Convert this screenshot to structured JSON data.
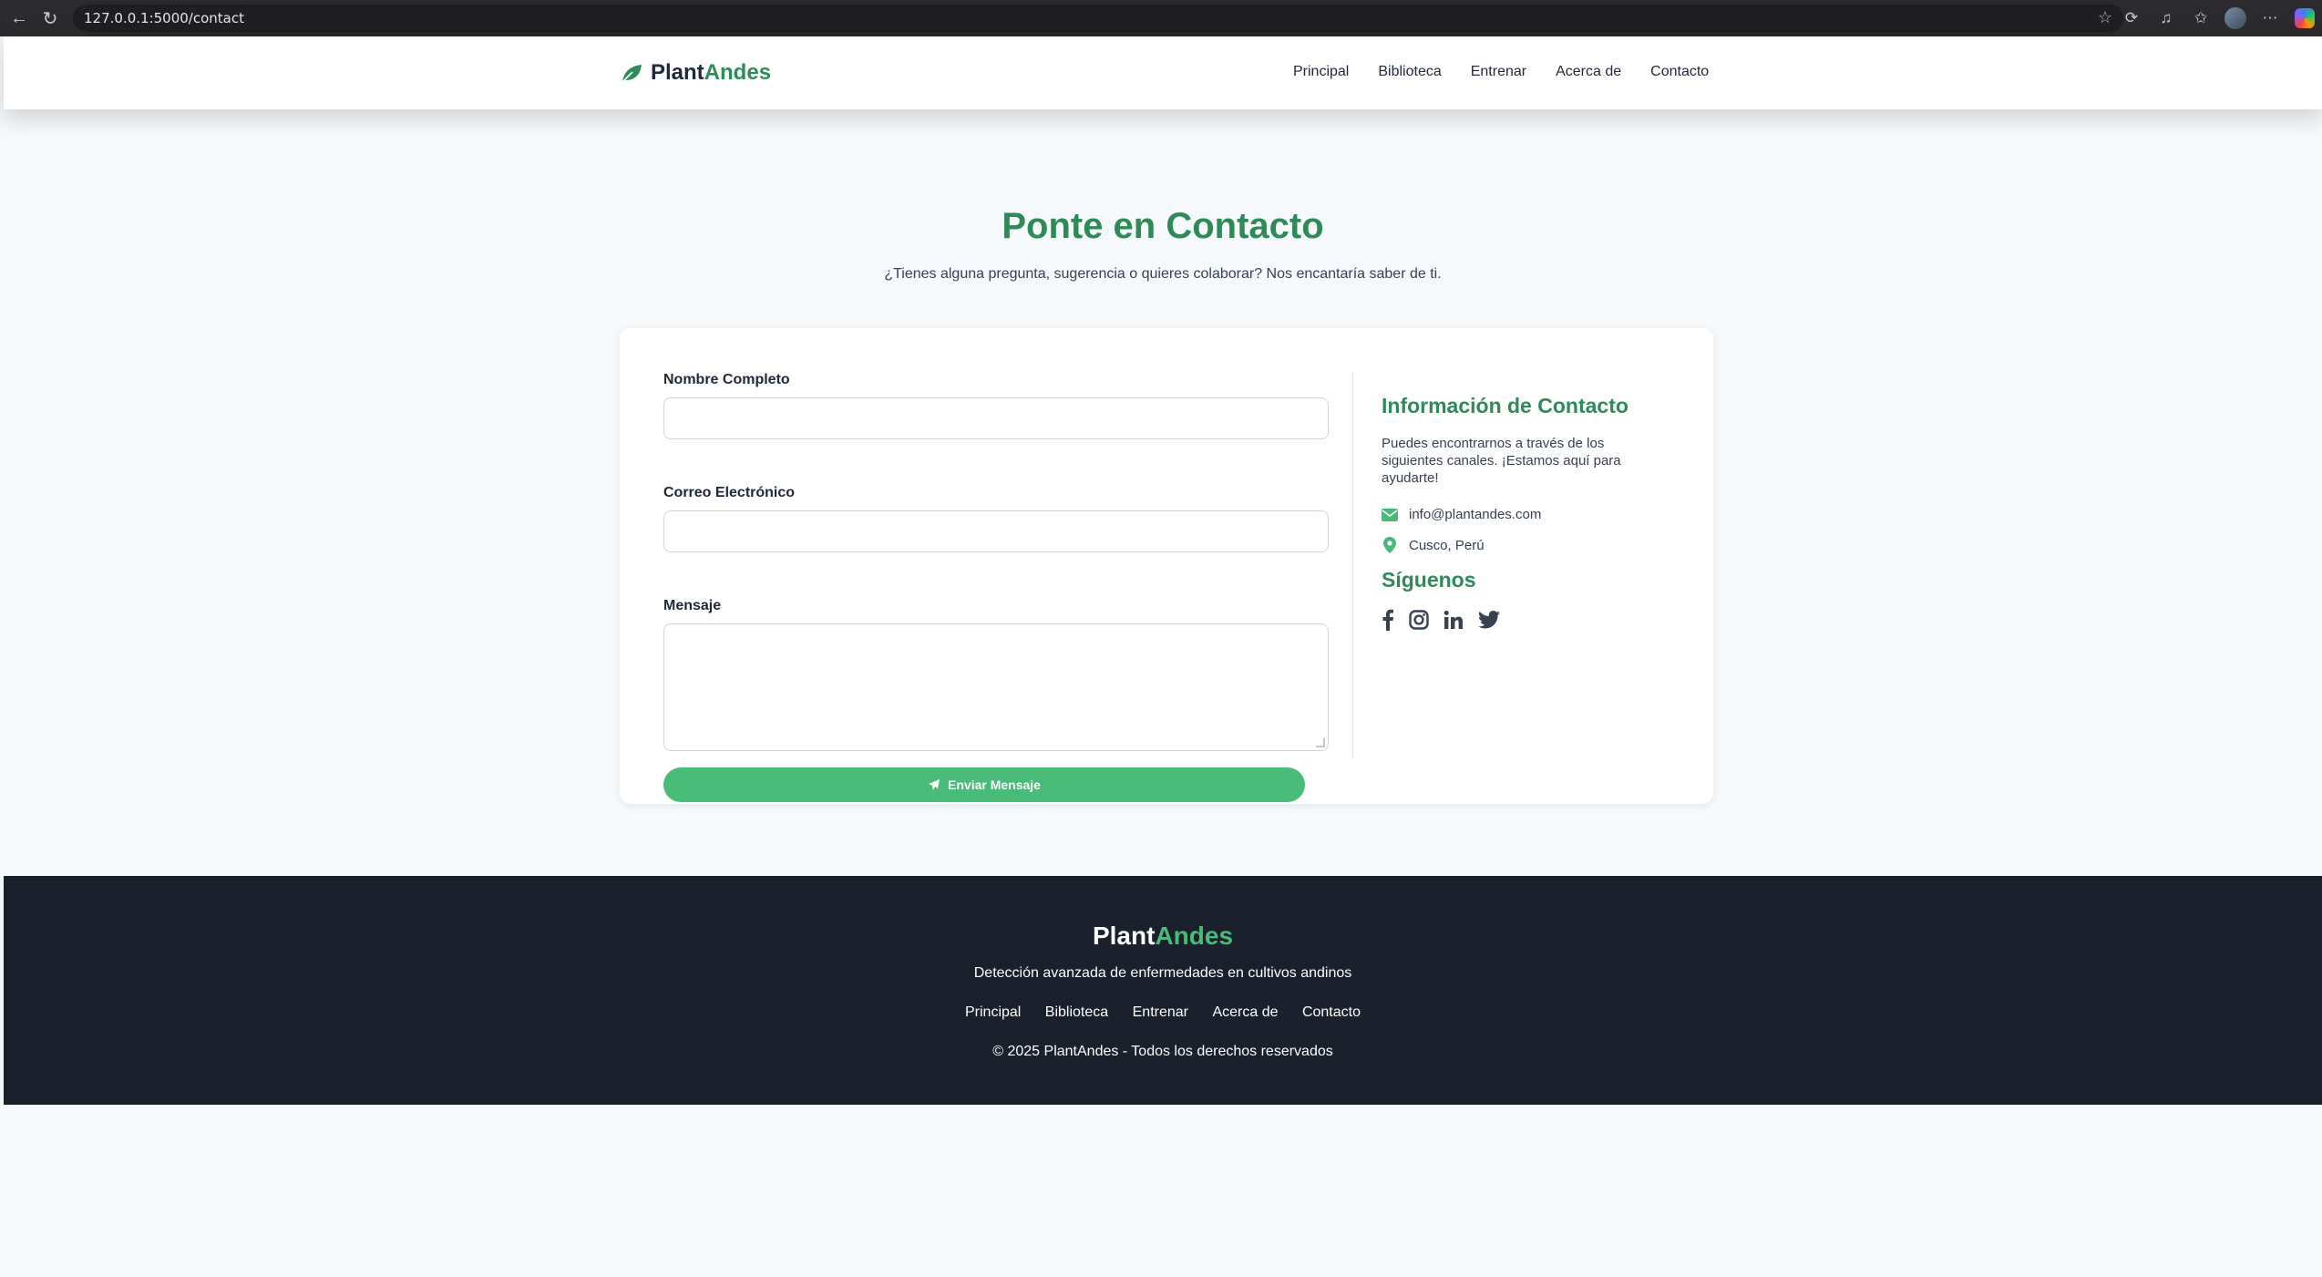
{
  "browser": {
    "url": "127.0.0.1:5000/contact"
  },
  "header": {
    "logo_plant": "Plant",
    "logo_andes": "Andes",
    "nav": [
      "Principal",
      "Biblioteca",
      "Entrenar",
      "Acerca de",
      "Contacto"
    ]
  },
  "hero": {
    "title": "Ponte en Contacto",
    "subtitle": "¿Tienes alguna pregunta, sugerencia o quieres colaborar? Nos encantaría saber de ti."
  },
  "form": {
    "name_label": "Nombre Completo",
    "name_value": "",
    "email_label": "Correo Electrónico",
    "email_value": "",
    "message_label": "Mensaje",
    "message_value": "",
    "submit_label": "Enviar Mensaje"
  },
  "contact_info": {
    "title": "Información de Contacto",
    "description": "Puedes encontrarnos a través de los siguientes canales. ¡Estamos aquí para ayudarte!",
    "email": "info@plantandes.com",
    "location": "Cusco, Perú",
    "social_title": "Síguenos",
    "social": [
      "facebook-icon",
      "instagram-icon",
      "linkedin-icon",
      "twitter-icon"
    ]
  },
  "footer": {
    "logo_plant": "Plant",
    "logo_andes": "Andes",
    "tagline": "Detección avanzada de enfermedades en cultivos andinos",
    "links": [
      "Principal",
      "Biblioteca",
      "Entrenar",
      "Acerca de",
      "Contacto"
    ],
    "copyright": "© 2025 PlantAndes - Todos los derechos reservados"
  },
  "colors": {
    "brand_green": "#2e8b57",
    "button_green": "#48bb78",
    "footer_bg": "#1a202c"
  }
}
